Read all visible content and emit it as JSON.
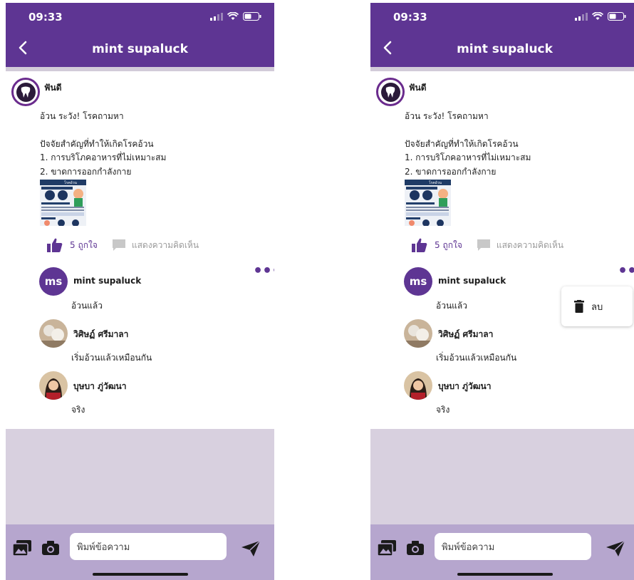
{
  "status": {
    "time": "09:33"
  },
  "header": {
    "title": "mint supaluck"
  },
  "post": {
    "author": "ฟันดี",
    "line1": "อ้วน ระวัง! โรคถามหา",
    "line2": "ปัจจัยสำคัญที่ทำให้เกิดโรคอ้วน",
    "line3": "1. การบริโภคอาหารที่ไม่เหมาะสม",
    "line4": "2. ขาดการออกกำลังกาย",
    "image_caption": "โรคอ้วน"
  },
  "actions": {
    "like_label": "5  ถูกใจ",
    "comment_label": "แสดงความคิดเห็น"
  },
  "comments": [
    {
      "initials": "ms",
      "name": "mint supaluck",
      "text": "อ้วนแล้ว"
    },
    {
      "name": "วิศิษฏ์ ศรีมาลา",
      "text": "เริ่มอ้วนแล้วเหมือนกัน"
    },
    {
      "name": "บุษบา ภู่วัฒนา",
      "text": "จริง"
    }
  ],
  "composer": {
    "placeholder": "พิมพ์ข้อความ"
  },
  "menu": {
    "delete_label": "ลบ"
  },
  "colors": {
    "primary": "#5e3593",
    "composer_bg": "#b6a6ce",
    "empty_bg": "#d8d0df",
    "muted": "#9a9a9a"
  },
  "icons": [
    "back-icon",
    "signal-icon",
    "wifi-icon",
    "battery-icon",
    "tooth-icon",
    "thumbs-up-icon",
    "comment-icon",
    "more-icon",
    "gallery-icon",
    "camera-icon",
    "send-icon",
    "trash-icon"
  ]
}
